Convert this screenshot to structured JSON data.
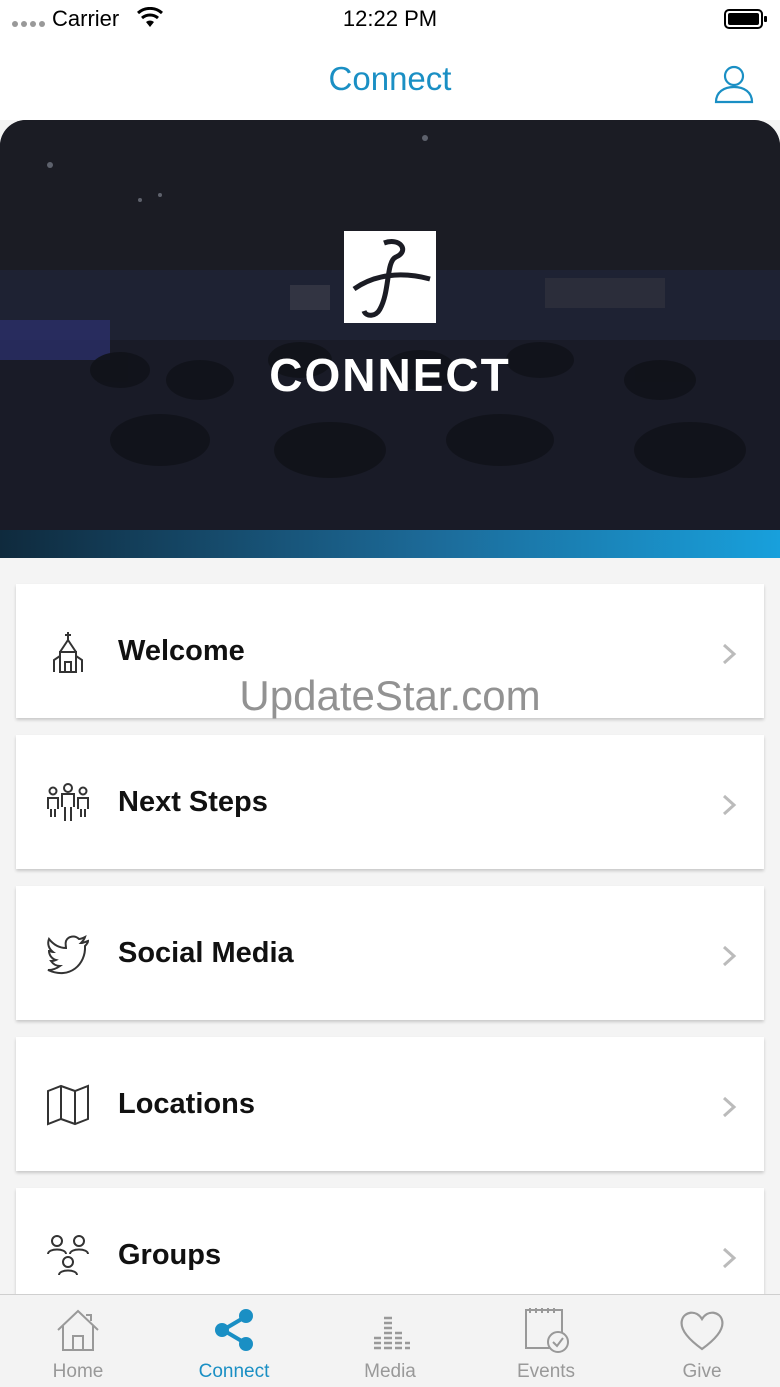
{
  "status_bar": {
    "carrier": "Carrier",
    "time": "12:22 PM"
  },
  "nav": {
    "title": "Connect",
    "profile_icon": "user-icon"
  },
  "hero": {
    "word": "CONNECT",
    "logo_icon": "church-logo-icon"
  },
  "list": [
    {
      "label": "Welcome",
      "icon": "church-icon"
    },
    {
      "label": "Next Steps",
      "icon": "people-icon"
    },
    {
      "label": "Social Media",
      "icon": "twitter-icon"
    },
    {
      "label": "Locations",
      "icon": "map-icon"
    },
    {
      "label": "Groups",
      "icon": "group-icon"
    }
  ],
  "watermark": "UpdateStar.com",
  "tabs": [
    {
      "label": "Home",
      "icon": "home-icon",
      "active": false
    },
    {
      "label": "Connect",
      "icon": "share-icon",
      "active": true
    },
    {
      "label": "Media",
      "icon": "media-icon",
      "active": false
    },
    {
      "label": "Events",
      "icon": "calendar-icon",
      "active": false
    },
    {
      "label": "Give",
      "icon": "heart-icon",
      "active": false
    }
  ],
  "colors": {
    "accent": "#1a8fc4",
    "tab_inactive": "#999999"
  }
}
